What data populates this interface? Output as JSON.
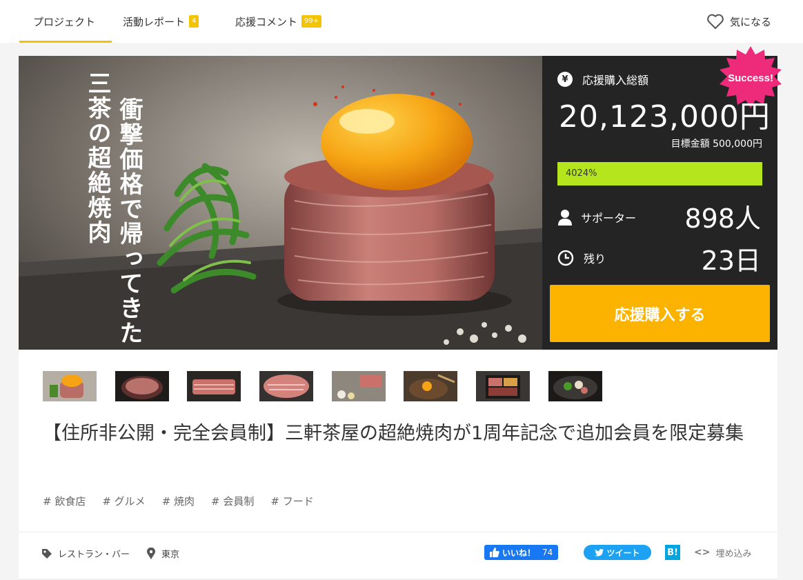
{
  "nav": {
    "tabs": [
      {
        "label": "プロジェクト",
        "count": ""
      },
      {
        "label": "活動レポート",
        "count": "4"
      },
      {
        "label": "応援コメント",
        "count": "99+"
      }
    ],
    "favorite_label": "気になる"
  },
  "hero": {
    "vertical_text_1": "衝撃価格で帰ってきた",
    "vertical_text_2": "三茶の超絶焼肉"
  },
  "stats": {
    "yen_icon": "¥",
    "total_label": "応援購入総額",
    "total_value": "20,123,000円",
    "goal_label": "目標金額 500,000円",
    "progress_percent": 4024,
    "progress_text": "4024%",
    "supporters_label": "サポーター",
    "supporters_value": "898人",
    "remaining_label": "残り",
    "remaining_value": "23日",
    "buy_button": "応援購入する",
    "success_badge": "Success!"
  },
  "thumbnails": [
    "yakiniku-top",
    "meat-bowl",
    "sliced-meat-1",
    "sliced-meat-2",
    "wagyu-plate",
    "egg-noodle-bowl",
    "bento-box",
    "hotpot"
  ],
  "project": {
    "title": "【住所非公開・完全会員制】三軒茶屋の超絶焼肉が1周年記念で追加会員を限定募集",
    "tags": [
      "# 飲食店",
      "# グルメ",
      "# 焼肉",
      "# 会員制",
      "# フード"
    ],
    "category": "レストラン・バー",
    "location": "東京"
  },
  "social": {
    "like_label": "いいね！",
    "like_count": "74",
    "tweet_label": "ツイート",
    "hatena_label": "B!",
    "embed_label": "埋め込み",
    "embed_icon": "<>"
  },
  "colors": {
    "accent": "#f5c400",
    "buy": "#fbb300",
    "progress": "#b5e61d",
    "panel": "#242424",
    "badge": "#ee2a7b"
  }
}
